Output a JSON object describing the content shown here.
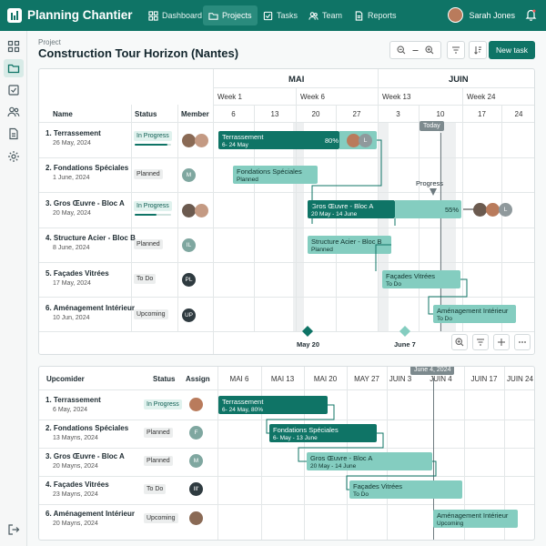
{
  "app": {
    "title": "Planning Chantier"
  },
  "nav": [
    {
      "label": "Dashboard"
    },
    {
      "label": "Projects"
    },
    {
      "label": "Tasks"
    },
    {
      "label": "Team"
    },
    {
      "label": "Reports"
    }
  ],
  "user": {
    "name": "Sarah Jones"
  },
  "page": {
    "breadcrumb": "Project",
    "title": "Construction Tour Horizon (Nantes)",
    "new_task": "New task"
  },
  "colors": {
    "accent": "#0f7466",
    "bar_light": "#84cdc0"
  },
  "gantt": {
    "months": [
      "MAI",
      "JUIN"
    ],
    "weeks": [
      "Week 1",
      "Week 6",
      "Week 13",
      "Week 24"
    ],
    "days": [
      "6",
      "13",
      "20",
      "27",
      "3",
      "10",
      "17",
      "24"
    ],
    "columns": {
      "name": "Name",
      "status": "Status",
      "member": "Member"
    },
    "today_label": "Today",
    "progress_label": "Progress",
    "milestones": [
      "May 20",
      "June 7"
    ],
    "tasks": [
      {
        "name": "1. Terrassement",
        "date": "26 May, 2024",
        "status": "In Progress",
        "progress": 0.9,
        "bar_label": "Terrassement",
        "bar_sub": "6- 24 May",
        "bar_pct": "80%",
        "member_initial": "L"
      },
      {
        "name": "2. Fondations Spéciales",
        "date": "1 June, 2024",
        "status": "Planned",
        "member_initial": "M",
        "bar_label": "Fondations Spéciales",
        "bar_sub": "Planned"
      },
      {
        "name": "3. Gros Œuvre - Bloc A",
        "date": "20 May, 2024",
        "status": "In Progress",
        "progress": 0.6,
        "bar_label": "Gros Œuvre - Bloc A",
        "bar_sub": "20 May - 14 June",
        "bar_pct": "55%",
        "member_initial": "L"
      },
      {
        "name": "4. Structure Acier - Bloc B",
        "date": "8 June, 2024",
        "status": "Planned",
        "member_initial": "IL",
        "bar_label": "Structure Acier - Bloc B",
        "bar_sub": "Planned"
      },
      {
        "name": "5. Façades Vitrées",
        "date": "17 May, 2024",
        "status": "To Do",
        "member_initial": "PL",
        "bar_label": "Façades Vitrées",
        "bar_sub": "To Do"
      },
      {
        "name": "6. Aménagement Intérieur",
        "date": "10 Jun, 2024",
        "status": "Upcoming",
        "member_initial": "UP",
        "bar_label": "Aménagement Intérieur",
        "bar_sub": "To Do"
      }
    ]
  },
  "upcoming": {
    "columns": {
      "name": "Upcomider",
      "status": "Status",
      "assign": "Assign"
    },
    "dates": [
      "MAI 6",
      "MAI 13",
      "MAI 20",
      "MAY 27",
      "JUIN 3",
      "JUIN 4",
      "JUIN 17",
      "JUIN 24"
    ],
    "date_tag": "June 4, 2024",
    "tasks": [
      {
        "name": "1. Terrassement",
        "date": "6 May, 2024",
        "status": "In Progress",
        "bar_label": "Terrassement",
        "bar_sub": "6- 24 May, 80%"
      },
      {
        "name": "2. Fondations Spéciales",
        "date": "13 Mayns, 2024",
        "status": "Planned",
        "member_initial": "F",
        "bar_label": "Fondations Spéciales",
        "bar_sub": "6- May - 13 June"
      },
      {
        "name": "3. Gros Œuvre - Bloc A",
        "date": "20 Mayns, 2024",
        "status": "Planned",
        "member_initial": "M",
        "bar_label": "Gros Œuvre - Bloc A",
        "bar_sub": "20 May - 14 June"
      },
      {
        "name": "4. Façades Vitrées",
        "date": "23 Mayns, 2024",
        "status": "To Do",
        "member_initial": "Ill'",
        "bar_label": "Façades Vitrées",
        "bar_sub": "To Do"
      },
      {
        "name": "6. Aménagement Intérieur",
        "date": "20 Mayns, 2024",
        "status": "Upcoming",
        "bar_label": "Aménagement Intérieur",
        "bar_sub": "Upcoming"
      }
    ]
  }
}
